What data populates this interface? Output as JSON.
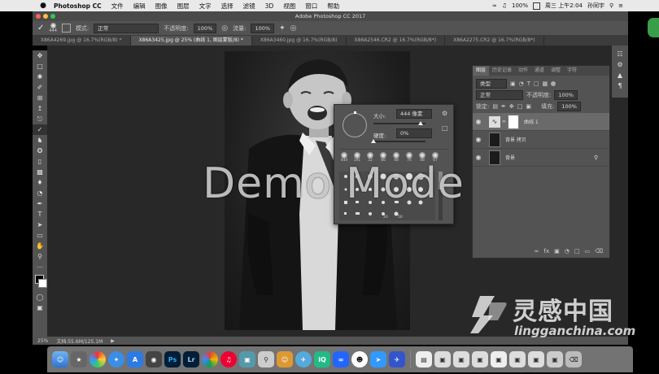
{
  "menubar": {
    "apple": "",
    "app": "Photoshop CC",
    "items": [
      "文件",
      "编辑",
      "图像",
      "图层",
      "文字",
      "选择",
      "滤镜",
      "3D",
      "视图",
      "窗口",
      "帮助"
    ],
    "window_title": "Adobe Photoshop CC 2017",
    "battery": "100%",
    "clock": "周三 上午2:04",
    "user": "孙同宇"
  },
  "options_bar": {
    "brush_size": "444",
    "mode_label": "模式:",
    "mode_value": "正常",
    "opacity_label": "不透明度:",
    "opacity_value": "100%",
    "flow_label": "流量:",
    "flow_value": "100%"
  },
  "tabs": [
    "X86A4269.jpg @ 16.7%(RGB/8) *",
    "X86A3425.jpg @ 25% (曲线 1, 图层蒙版/8) *",
    "X86A3460.jpg @ 16.7%(RGB/8)",
    "X86A2546.CR2 @ 16.7%(RGB/8*)",
    "X86A2275.CR2 @ 16.7%(RGB/8*)"
  ],
  "brush_picker": {
    "size_label": "大小:",
    "size_value": "444 像素",
    "hardness_label": "硬度:",
    "hardness_value": "0%",
    "preset_sizes": [
      "444",
      "191",
      "32",
      "66",
      "48",
      "76",
      "48",
      "67"
    ],
    "bottom_sizes": [
      "20",
      "50"
    ]
  },
  "layers_panel": {
    "tabs": [
      "图层",
      "历史记录",
      "动作",
      "通道",
      "调整",
      "字符"
    ],
    "kind_label": "类型",
    "blend_mode": "正常",
    "opacity_label": "不透明度:",
    "opacity_value": "100%",
    "lock_label": "锁定:",
    "fill_label": "填充:",
    "fill_value": "100%",
    "layers": [
      {
        "name": "曲线 1"
      },
      {
        "name": "背景 拷贝"
      },
      {
        "name": "背景"
      }
    ]
  },
  "status": {
    "zoom": "25%",
    "doc": "文档:55.6M/125.1M"
  },
  "overlay": {
    "demo_text": "Demo Mode",
    "watermark_cn": "灵感中国",
    "watermark_url": "lingganchina.com"
  },
  "colors": {
    "panel": "#535353",
    "canvas": "#282828",
    "ps_blue": "#31a8ff",
    "lr_blue": "#a4c7ec"
  }
}
